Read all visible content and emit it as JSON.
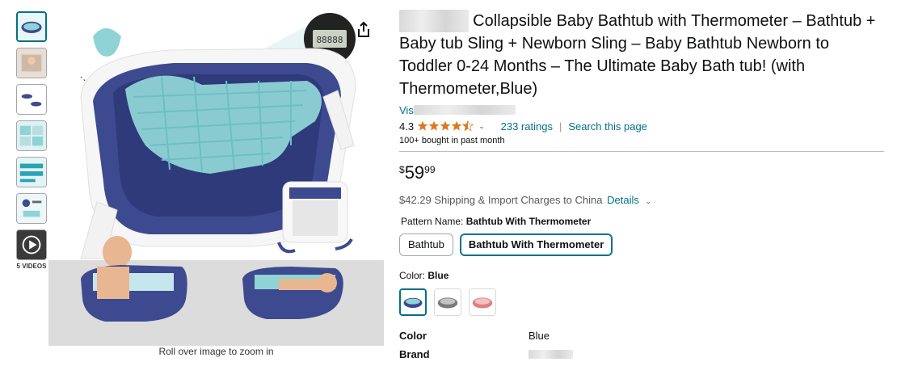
{
  "gallery": {
    "thumbnails": [
      {
        "name": "thumb-1",
        "active": true
      },
      {
        "name": "thumb-2",
        "active": false
      },
      {
        "name": "thumb-3",
        "active": false
      },
      {
        "name": "thumb-4",
        "active": false
      },
      {
        "name": "thumb-5",
        "active": false
      },
      {
        "name": "thumb-6",
        "active": false
      }
    ],
    "videos_label": "5 VIDEOS",
    "zoom_hint": "Roll over image to zoom in",
    "display_reading": "88888"
  },
  "product": {
    "title_rest": " Collapsible Baby Bathtub with Thermometer – Bathtub + Baby tub Sling + Newborn Sling – Baby Bathtub Newborn to Toddler 0-24 Months – The Ultimate Baby Bath tub! (with Thermometer,Blue)",
    "store_link_prefix": "Vis",
    "rating": "4.3",
    "stars": 4.3,
    "ratings_count": "233 ratings",
    "search_page": "Search this page",
    "bought": "100+ bought in past month",
    "price_currency": "$",
    "price_whole": "59",
    "price_fraction": "99",
    "shipping": "$42.29 Shipping & Import Charges to China",
    "details_link": "Details",
    "pattern_label": "Pattern Name:",
    "pattern_selected": "Bathtub With Thermometer",
    "pattern_options": [
      "Bathtub",
      "Bathtub With Thermometer"
    ],
    "color_label": "Color:",
    "color_selected": "Blue",
    "swatch_colors": [
      "#3d4a8f",
      "#7a7a7a",
      "#e07f7f"
    ],
    "specs": [
      {
        "key": "Color",
        "value": "Blue"
      },
      {
        "key": "Brand",
        "value": ""
      }
    ]
  },
  "colors": {
    "link": "#007185",
    "tub_blue": "#3d4a8f",
    "mesh": "#8fd3d6",
    "star": "#de7921"
  }
}
